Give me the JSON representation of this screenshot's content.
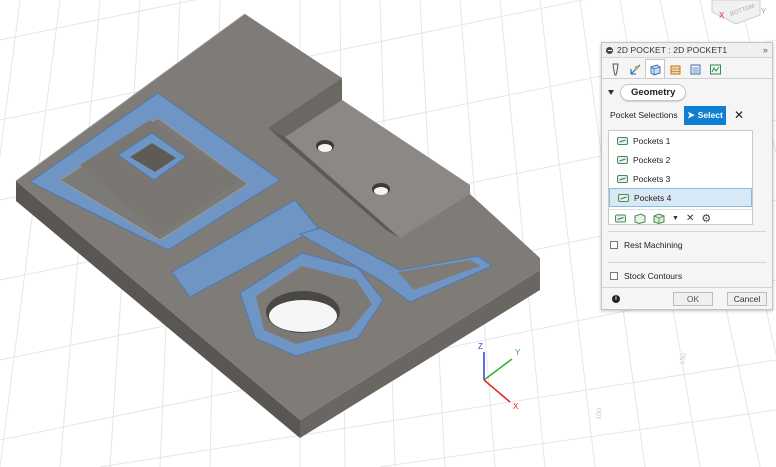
{
  "dialog": {
    "title": "2D POCKET : 2D POCKET1",
    "pin_icon": "double-chevron-right-icon",
    "tabs": [
      "tool-tab",
      "heights-tab",
      "geometry-tab",
      "passes-tab",
      "linking-tab",
      "simulation-tab"
    ],
    "section_title": "Geometry",
    "pocket_selections_label": "Pocket Selections",
    "select_button_label": "Select",
    "selections": [
      {
        "label": "Pockets 1",
        "highlighted": false
      },
      {
        "label": "Pockets 2",
        "highlighted": false
      },
      {
        "label": "Pockets 3",
        "highlighted": false
      },
      {
        "label": "Pockets 4",
        "highlighted": true
      }
    ],
    "rest_machining_label": "Rest Machining",
    "stock_contours_label": "Stock Contours",
    "ok_label": "OK",
    "cancel_label": "Cancel"
  },
  "triad": {
    "x": "X",
    "y": "Y",
    "z": "Z"
  },
  "viewcube_label": "BOTTOM",
  "colors": {
    "accent": "#0f7fd1",
    "pocket_blue": "#6f95c4",
    "part_gray": "#7f7c77",
    "axis_x": "#e02020",
    "axis_y": "#2fb52f",
    "axis_z": "#2a3fd6"
  }
}
